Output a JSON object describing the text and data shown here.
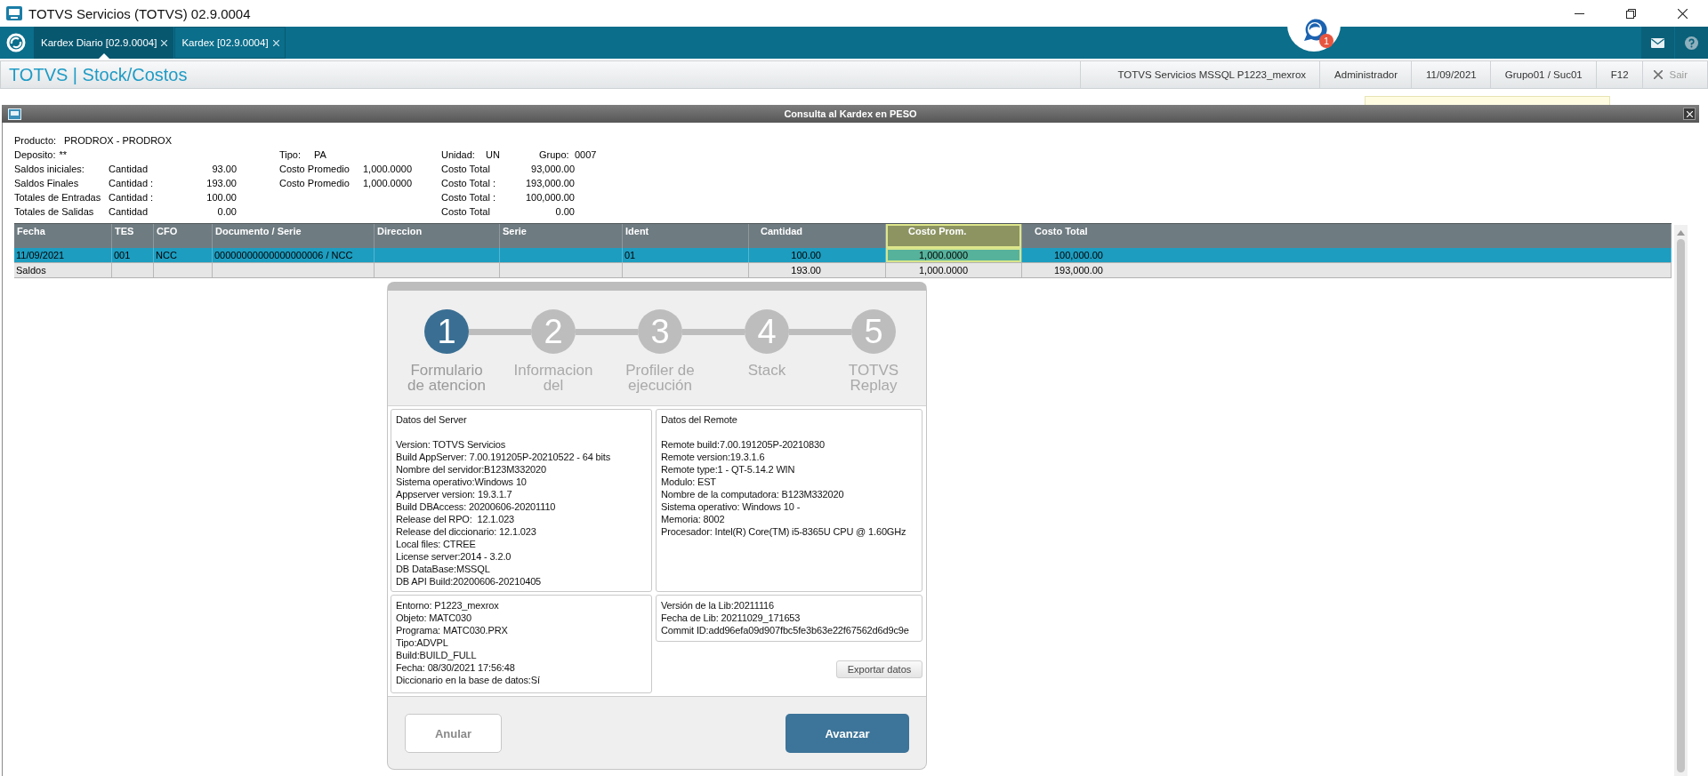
{
  "window": {
    "title": "TOTVS Servicios (TOTVS) 02.9.0004"
  },
  "tabs": [
    {
      "label": "Kardex Diario [02.9.0004]",
      "selected": true
    },
    {
      "label": "Kardex [02.9.0004]",
      "selected": false
    }
  ],
  "notification": {
    "count": "1"
  },
  "header": {
    "title": "TOTVS | Stock/Costos",
    "status_items": [
      "TOTVS Servicios MSSQL P1223_mexrox",
      "Administrador",
      "11/09/2021",
      "Grupo01 / Suc01",
      "F12"
    ],
    "exit_label": "Sair"
  },
  "dialog": {
    "title": "Consulta al Kardex en PESO",
    "product": {
      "label": "Producto:",
      "value": "PRODROX - PRODROX"
    },
    "attributes": [
      {
        "label": "Deposito:",
        "value": "**"
      },
      {
        "label": "Tipo:",
        "value": "PA"
      },
      {
        "label": "Unidad:",
        "value": "UN"
      },
      {
        "label": "Grupo:",
        "value": "0007"
      }
    ],
    "balances": [
      {
        "label": "Saldos iniciales:",
        "quantity_label": "Cantidad",
        "quantity": "93.00",
        "average_label": "Costo Promedio",
        "average": "1,000.0000",
        "total_label": "Costo Total",
        "total": "93,000.00"
      },
      {
        "label": "Saldos Finales",
        "quantity_label": "Cantidad :",
        "quantity": "193.00",
        "average_label": "Costo Promedio",
        "average": "1,000.0000",
        "total_label": "Costo Total :",
        "total": "193,000.00"
      },
      {
        "label": "Totales de Entradas",
        "quantity_label": "Cantidad :",
        "quantity": "100.00",
        "total_label": "Costo Total :",
        "total": "100,000.00"
      },
      {
        "label": "Totales de Salidas",
        "quantity_label": "Cantidad",
        "quantity": "0.00",
        "total_label": "Costo Total",
        "total": "0.00"
      }
    ],
    "table": {
      "columns": [
        {
          "label": "Fecha",
          "highlighted": false
        },
        {
          "label": "TES",
          "highlighted": false
        },
        {
          "label": "CFO",
          "highlighted": false
        },
        {
          "label": "Documento / Serie",
          "highlighted": false
        },
        {
          "label": "Direccion",
          "highlighted": false
        },
        {
          "label": "Serie",
          "highlighted": false
        },
        {
          "label": "Ident",
          "highlighted": false
        },
        {
          "label": "Cantidad",
          "highlighted": false
        },
        {
          "label": "Costo Prom.",
          "highlighted": true
        },
        {
          "label": "Costo Total",
          "highlighted": false
        }
      ],
      "rows": [
        {
          "selected": true,
          "cells": [
            "11/09/2021",
            "001",
            "NCC",
            "00000000000000000006 / NCC",
            null,
            null,
            "01",
            "100.00",
            "1,000.0000",
            "100,000.00"
          ]
        },
        {
          "selected": false,
          "cells": [
            "Saldos",
            null,
            null,
            null,
            null,
            null,
            null,
            "193.00",
            "1,000.0000",
            "193,000.00"
          ]
        }
      ]
    },
    "wizard": {
      "steps": [
        {
          "number": "1",
          "label": "Formulario de atencion",
          "selected": true
        },
        {
          "number": "2",
          "label": "Informacion del",
          "selected": false
        },
        {
          "number": "3",
          "label": "Profiler de ejecución",
          "selected": false
        },
        {
          "number": "4",
          "label": "Stack",
          "selected": false
        },
        {
          "number": "5",
          "label": "TOTVS Replay",
          "selected": false
        }
      ],
      "server_info": {
        "title": "Datos del Server",
        "lines": [
          "Version: TOTVS Servicios",
          "Build AppServer: 7.00.191205P-20210522 - 64 bits",
          "Nombre del servidor:B123M332020",
          "Sistema operativo:Windows 10",
          "Appserver version: 19.3.1.7",
          "Build DBAccess: 20200606-20201110",
          "Release del RPO:  12.1.023",
          "Release del diccionario: 12.1.023",
          "Local files: CTREE",
          "License server:2014 - 3.2.0",
          "DB DataBase:MSSQL",
          "DB API Build:20200606-20210405"
        ]
      },
      "remote_info": {
        "title": "Datos del Remote",
        "lines": [
          "Remote build:7.00.191205P-20210830",
          "Remote version:19.3.1.6",
          "Remote type:1 - QT-5.14.2 WIN",
          "Modulo: EST",
          "Nombre de la computadora: B123M332020",
          "Sistema operativo: Windows 10 -",
          "Memoria: 8002",
          "Procesador: Intel(R) Core(TM) i5-8365U CPU @ 1.60GHz"
        ]
      },
      "environment_info": {
        "lines": [
          "Entorno: P1223_mexrox",
          "Objeto: MATC030",
          "Programa: MATC030.PRX",
          "Tipo:ADVPL",
          "Build:BUILD_FULL",
          "Fecha: 08/30/2021 17:56:48",
          "Diccionario en la base de datos:Sí"
        ]
      },
      "library_info": {
        "lines": [
          "Versión de la Lib:20211116",
          "Fecha de Lib: 20211029_171653",
          "Commit ID:add96efa09d907fbc5fe3b63e22f67562d6d9c9e"
        ]
      },
      "export_button": "Exportar datos",
      "cancel_button": "Anular",
      "next_button": "Avanzar"
    }
  }
}
